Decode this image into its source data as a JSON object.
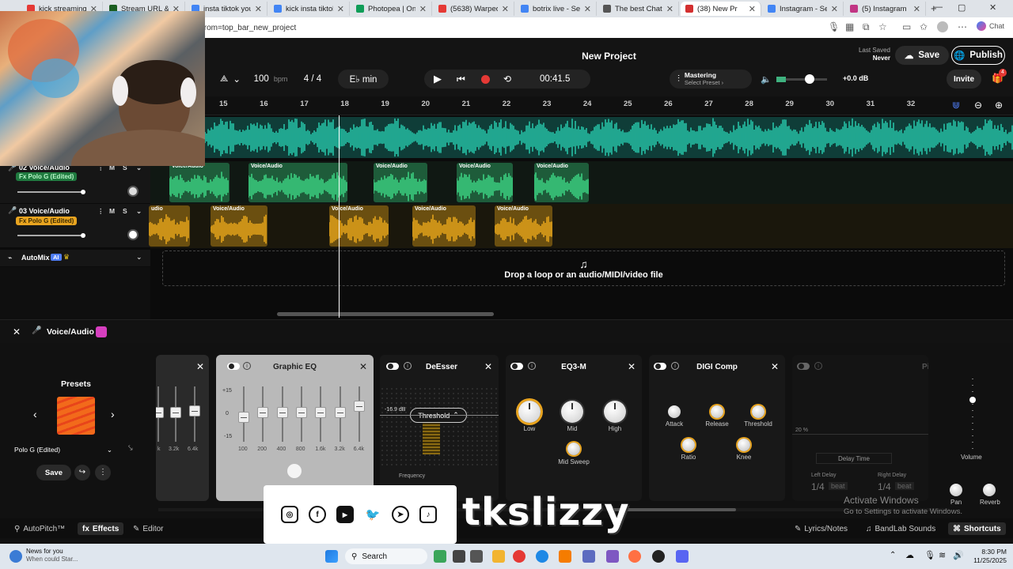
{
  "browser": {
    "tabs": [
      {
        "label": "kick streaming -",
        "color": "#e53935",
        "active": false
      },
      {
        "label": "Stream URL & Ke",
        "color": "#1b5e20",
        "active": false
      },
      {
        "label": "insta tiktok youtu",
        "color": "#4285f4",
        "active": false
      },
      {
        "label": "kick insta tiktok y",
        "color": "#4285f4",
        "active": false
      },
      {
        "label": "Photopea | Onlin",
        "color": "#0f9d58",
        "active": false
      },
      {
        "label": "(5638) Warped B",
        "color": "#e53935",
        "active": false
      },
      {
        "label": "botrix live - Sear",
        "color": "#4285f4",
        "active": false
      },
      {
        "label": "The best ChatBo",
        "color": "#555555",
        "active": false
      },
      {
        "label": "(38) New Pr",
        "color": "#d32f2f",
        "active": true
      },
      {
        "label": "Instagram - Sear",
        "color": "#4285f4",
        "active": false
      },
      {
        "label": "(5) Instagram",
        "color": "#c13584",
        "active": false
      }
    ],
    "new_tab": "+",
    "url": "from=top_bar_new_project",
    "chat_label": "Chat"
  },
  "header": {
    "title": "New Project",
    "bpm_value": "100",
    "bpm_unit": "bpm",
    "time_sig": "4 / 4",
    "key": "E♭ min",
    "time": "00:41.5",
    "mastering_label": "Mastering",
    "mastering_preset": "Select Preset ›",
    "volume_db": "+0.0 dB",
    "last_saved_label": "Last Saved",
    "last_saved_value": "Never",
    "save_label": "Save",
    "publish_label": "Publish",
    "invite_label": "Invite",
    "notif_count": "4"
  },
  "ruler": [
    "15",
    "16",
    "17",
    "18",
    "19",
    "20",
    "21",
    "22",
    "23",
    "24",
    "25",
    "26",
    "27",
    "28",
    "29",
    "30",
    "31",
    "32"
  ],
  "tracks": [
    {
      "name": "02  Voice/Audio",
      "fx": "Fx Polo G (Edited)",
      "m": "M",
      "s": "S"
    },
    {
      "name": "03  Voice/Audio",
      "fx": "Fx Polo G (Edited)",
      "m": "M",
      "s": "S"
    }
  ],
  "automix": {
    "label": "AutoMix",
    "badge": "AI"
  },
  "clip_label": "Voice/Audio",
  "clip_label_short": "udio",
  "drop_text": "Drop a loop or an audio/MIDI/video file",
  "fx": {
    "track_label": "Voice/Audio",
    "presets_title": "Presets",
    "preset_name": "Polo G (Edited)",
    "save_label": "Save",
    "graphic_eq_title": "Graphic EQ",
    "geq_db": [
      "+15",
      "0",
      "-15"
    ],
    "geq_freqs": [
      "100",
      "200",
      "400",
      "800",
      "1.6k",
      "3.2k",
      "6.4k"
    ],
    "prev_freqs": [
      "k",
      "3.2k",
      "6.4k"
    ],
    "deesser_title": "DeEsser",
    "deesser_db": "-16.9 dB",
    "threshold_label": "Threshold",
    "frequency_label": "Frequency",
    "eq3_title": "EQ3-M",
    "eq3_knobs": [
      "Low",
      "Mid",
      "High"
    ],
    "mid_sweep": "Mid Sweep",
    "digi_title": "DIGI Comp",
    "digi_knobs": [
      "Attack",
      "Release",
      "Threshold",
      "Ratio",
      "Knee"
    ],
    "delay_pct": "20 %",
    "delay_time": "Delay Time",
    "left_delay": "Left Delay",
    "right_delay": "Right Delay",
    "delay_val": "1/4",
    "beat": "beat",
    "volume_label": "Volume",
    "pan_label": "Pan",
    "reverb_label": "Reverb",
    "cut_title": "Pi"
  },
  "bottom": {
    "autopitch": "AutoPitch™",
    "effects": "Effects",
    "editor": "Editor",
    "lyrics": "Lyrics/Notes",
    "sounds": "BandLab Sounds",
    "shortcuts": "Shortcuts"
  },
  "overlay": {
    "handle": "tkslizzy"
  },
  "watermark": {
    "title": "Activate Windows",
    "sub": "Go to Settings to activate Windows."
  },
  "taskbar": {
    "news_title": "News for you",
    "news_sub": "When could Star...",
    "search": "Search",
    "time": "8:30 PM",
    "date": "11/25/2025"
  }
}
